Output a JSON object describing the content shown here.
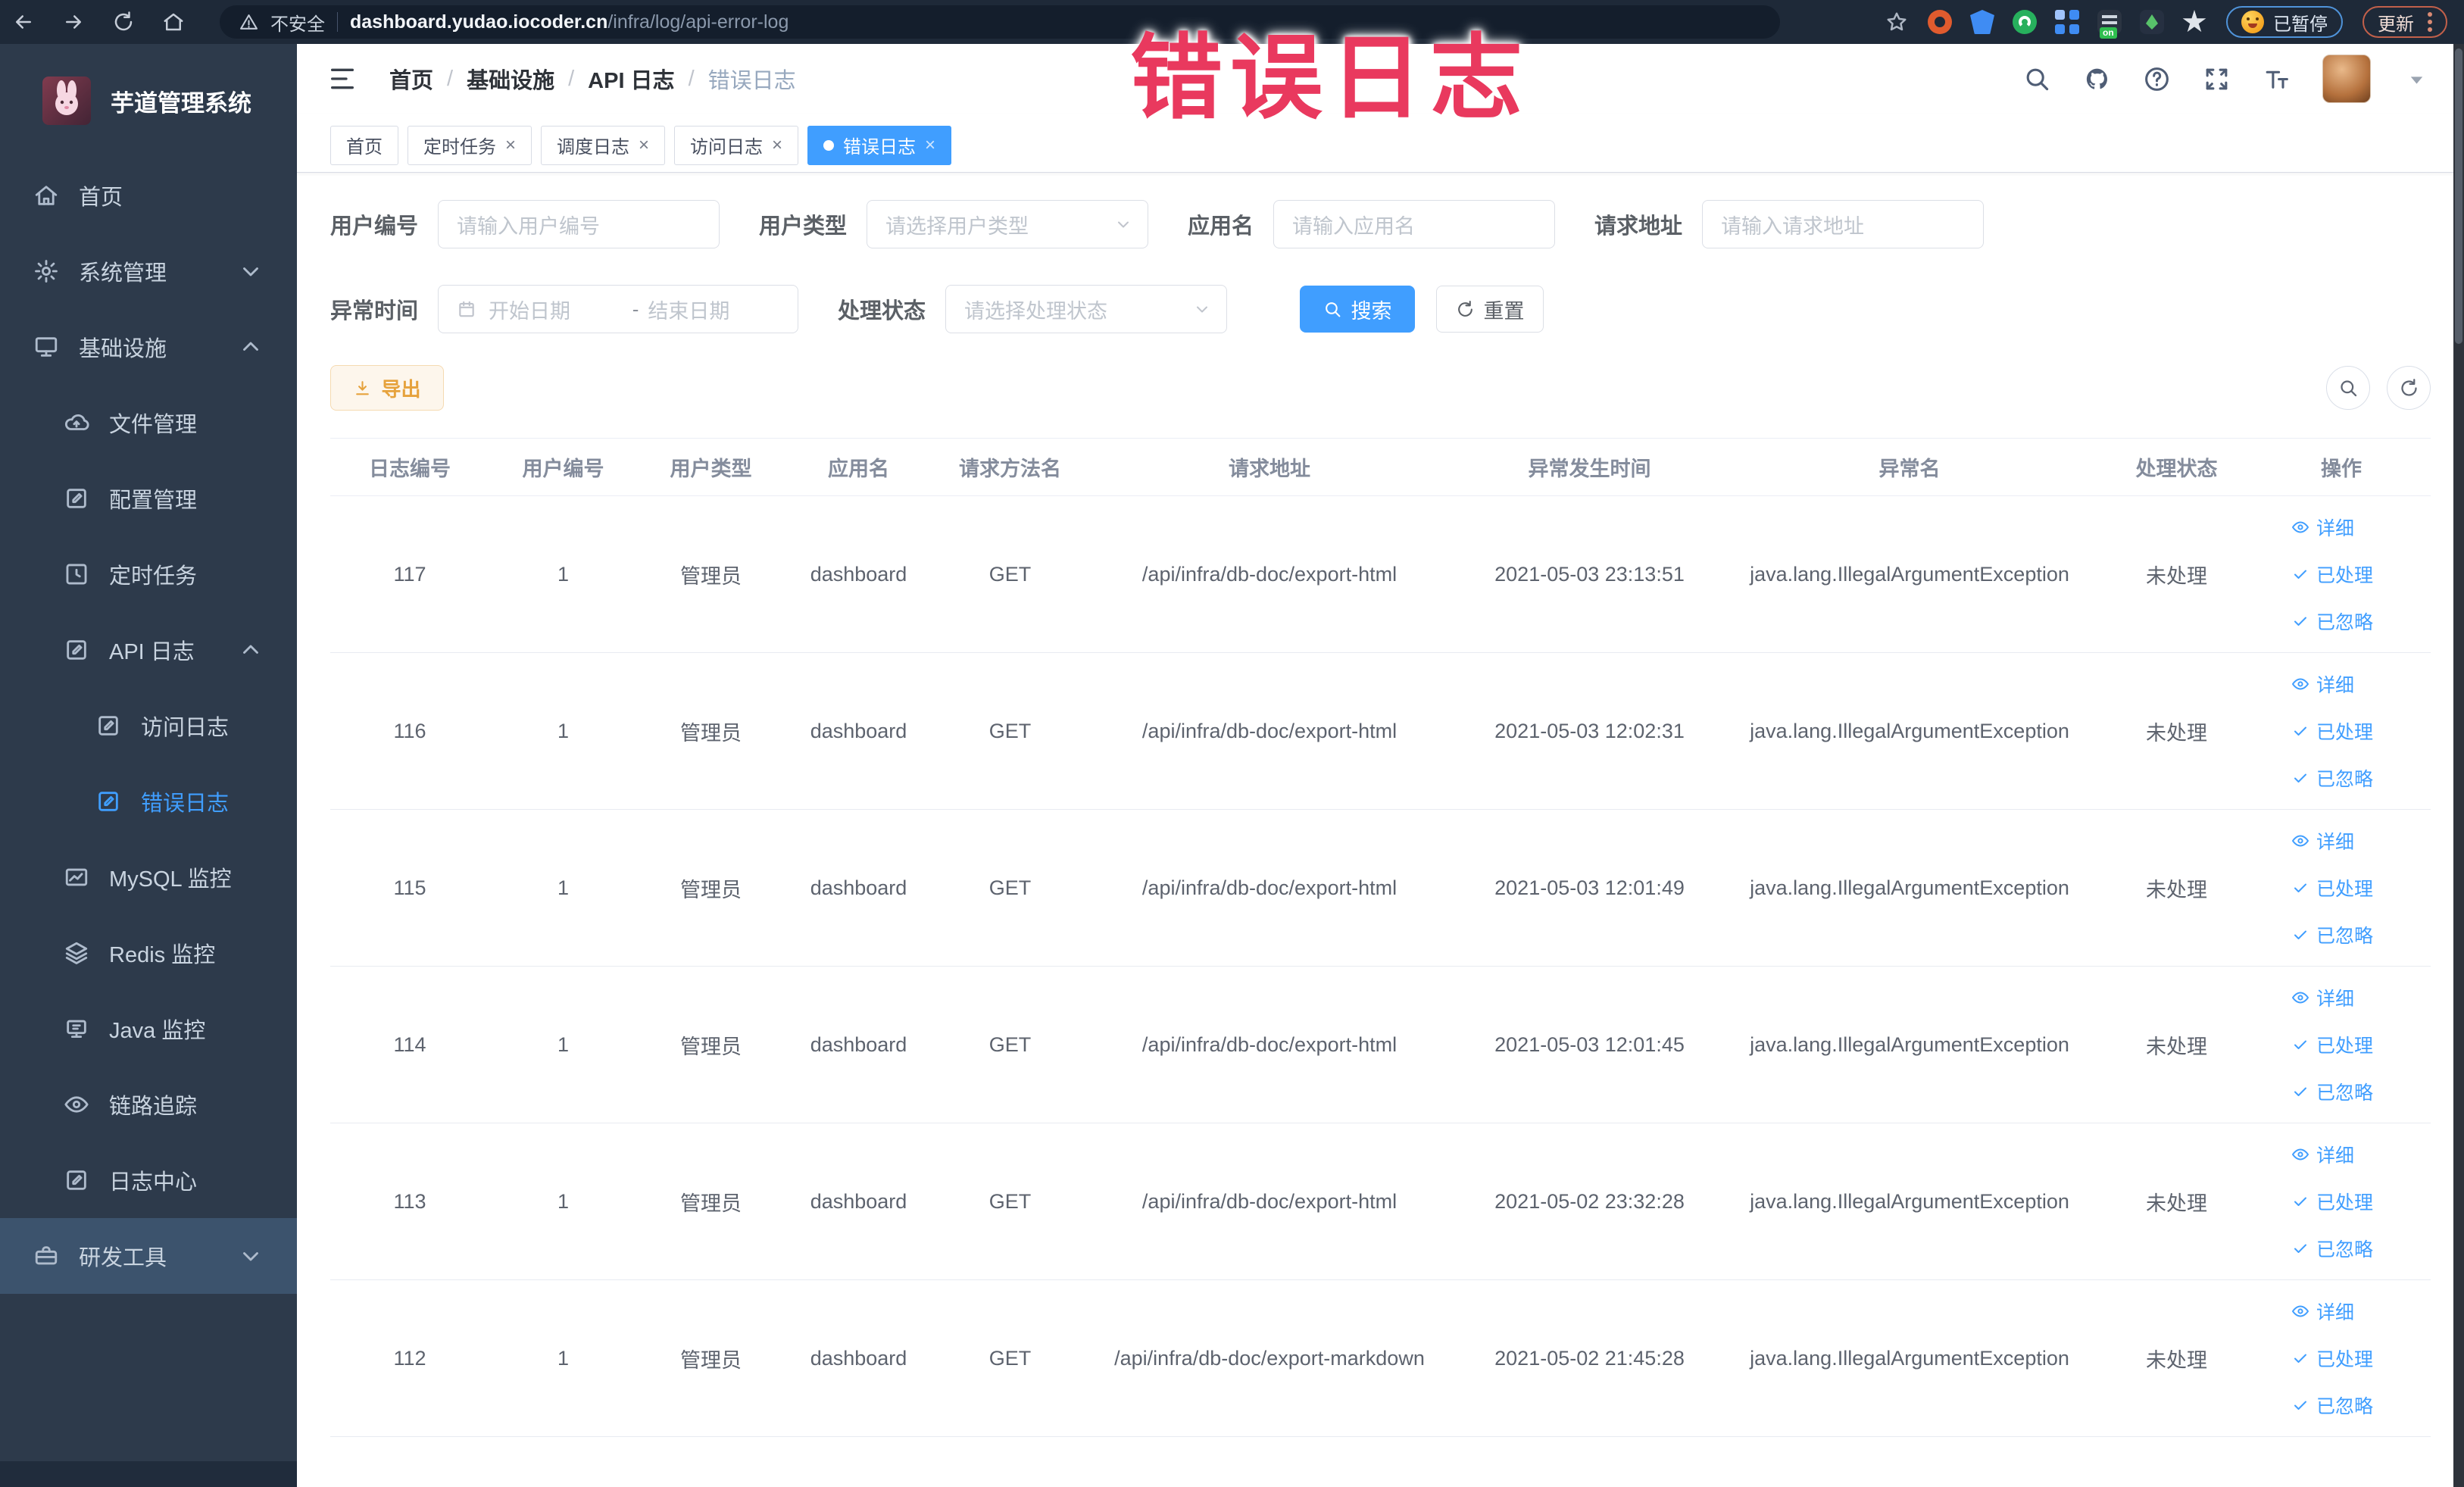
{
  "colors": {
    "accent": "#409eff",
    "warning": "#e6a23c",
    "overlay_red": "#e9395e",
    "sidebar_bg": "#2d3a4b"
  },
  "overlay": {
    "text": "错误日志"
  },
  "browser": {
    "security_label": "不安全",
    "url_domain": "dashboard.yudao.iocoder.cn",
    "url_path": "/infra/log/api-error-log",
    "paused_label": "已暂停",
    "update_label": "更新",
    "extensions": [
      {
        "name": "adblock-extension-icon",
        "style": "donut",
        "color": "#e05b2e"
      },
      {
        "name": "shield-extension-icon",
        "style": "shield",
        "color": "#3f8cf3"
      },
      {
        "name": "green-check-extension-icon",
        "style": "circle",
        "color": "#27b05d"
      },
      {
        "name": "grid-extension-icon",
        "style": "grid",
        "color": "#3f8cf3"
      },
      {
        "name": "switch-extension-icon",
        "style": "dark",
        "color": "#2b3442",
        "badge": "on"
      },
      {
        "name": "sprout-extension-icon",
        "style": "sprout",
        "color": "#263041"
      },
      {
        "name": "pin-extension-icon",
        "style": "puzzle",
        "color": "#dfe4ea"
      }
    ]
  },
  "sidebar": {
    "title": "芋道管理系统",
    "items": [
      {
        "key": "home",
        "label": "首页",
        "icon": "home",
        "level": 1
      },
      {
        "key": "system",
        "label": "系统管理",
        "icon": "gear",
        "level": 1,
        "chevron": "down"
      },
      {
        "key": "infra",
        "label": "基础设施",
        "icon": "monitor",
        "level": 1,
        "chevron": "up"
      },
      {
        "key": "file",
        "label": "文件管理",
        "icon": "cloud",
        "level": 2
      },
      {
        "key": "config",
        "label": "配置管理",
        "icon": "edit",
        "level": 2
      },
      {
        "key": "job",
        "label": "定时任务",
        "icon": "clock",
        "level": 2
      },
      {
        "key": "api-log",
        "label": "API 日志",
        "icon": "edit",
        "level": 2,
        "chevron": "up"
      },
      {
        "key": "access-log",
        "label": "访问日志",
        "icon": "edit",
        "level": 3
      },
      {
        "key": "error-log",
        "label": "错误日志",
        "icon": "edit",
        "level": 3,
        "active": true
      },
      {
        "key": "mysql",
        "label": "MySQL 监控",
        "icon": "chart",
        "level": 2
      },
      {
        "key": "redis",
        "label": "Redis 监控",
        "icon": "layers",
        "level": 2
      },
      {
        "key": "java",
        "label": "Java 监控",
        "icon": "java",
        "level": 2
      },
      {
        "key": "trace",
        "label": "链路追踪",
        "icon": "eye",
        "level": 2
      },
      {
        "key": "log-center",
        "label": "日志中心",
        "icon": "edit",
        "level": 2
      },
      {
        "key": "dev-tools",
        "label": "研发工具",
        "icon": "briefcase",
        "level": 1,
        "chevron": "down",
        "tone": "light"
      }
    ]
  },
  "header": {
    "breadcrumb": [
      "首页",
      "基础设施",
      "API 日志",
      "错误日志"
    ]
  },
  "tabs": [
    {
      "label": "首页",
      "active": false,
      "closable": false
    },
    {
      "label": "定时任务",
      "active": false,
      "closable": true
    },
    {
      "label": "调度日志",
      "active": false,
      "closable": true
    },
    {
      "label": "访问日志",
      "active": false,
      "closable": true
    },
    {
      "label": "错误日志",
      "active": true,
      "closable": true
    }
  ],
  "filters": {
    "row1": [
      {
        "key": "user-id",
        "label": "用户编号",
        "type": "input",
        "placeholder": "请输入用户编号"
      },
      {
        "key": "user-type",
        "label": "用户类型",
        "type": "select",
        "placeholder": "请选择用户类型"
      },
      {
        "key": "app-name",
        "label": "应用名",
        "type": "input",
        "placeholder": "请输入应用名"
      },
      {
        "key": "req-url",
        "label": "请求地址",
        "type": "input",
        "placeholder": "请输入请求地址"
      }
    ],
    "time": {
      "label": "异常时间",
      "start_placeholder": "开始日期",
      "separator": "-",
      "end_placeholder": "结束日期"
    },
    "status": {
      "label": "处理状态",
      "placeholder": "请选择处理状态"
    },
    "search_label": "搜索",
    "reset_label": "重置"
  },
  "toolbar": {
    "export_label": "导出"
  },
  "table": {
    "headers": [
      "日志编号",
      "用户编号",
      "用户类型",
      "应用名",
      "请求方法名",
      "请求地址",
      "异常发生时间",
      "异常名",
      "处理状态",
      "操作"
    ],
    "actions": [
      "详细",
      "已处理",
      "已忽略"
    ],
    "rows": [
      {
        "id": "117",
        "user_id": "1",
        "user_type": "管理员",
        "app": "dashboard",
        "method": "GET",
        "url": "/api/infra/db-doc/export-html",
        "time": "2021-05-03 23:13:51",
        "exception": "java.lang.IllegalArgumentException",
        "status": "未处理"
      },
      {
        "id": "116",
        "user_id": "1",
        "user_type": "管理员",
        "app": "dashboard",
        "method": "GET",
        "url": "/api/infra/db-doc/export-html",
        "time": "2021-05-03 12:02:31",
        "exception": "java.lang.IllegalArgumentException",
        "status": "未处理"
      },
      {
        "id": "115",
        "user_id": "1",
        "user_type": "管理员",
        "app": "dashboard",
        "method": "GET",
        "url": "/api/infra/db-doc/export-html",
        "time": "2021-05-03 12:01:49",
        "exception": "java.lang.IllegalArgumentException",
        "status": "未处理"
      },
      {
        "id": "114",
        "user_id": "1",
        "user_type": "管理员",
        "app": "dashboard",
        "method": "GET",
        "url": "/api/infra/db-doc/export-html",
        "time": "2021-05-03 12:01:45",
        "exception": "java.lang.IllegalArgumentException",
        "status": "未处理"
      },
      {
        "id": "113",
        "user_id": "1",
        "user_type": "管理员",
        "app": "dashboard",
        "method": "GET",
        "url": "/api/infra/db-doc/export-html",
        "time": "2021-05-02 23:32:28",
        "exception": "java.lang.IllegalArgumentException",
        "status": "未处理"
      },
      {
        "id": "112",
        "user_id": "1",
        "user_type": "管理员",
        "app": "dashboard",
        "method": "GET",
        "url": "/api/infra/db-doc/export-markdown",
        "time": "2021-05-02 21:45:28",
        "exception": "java.lang.IllegalArgumentException",
        "status": "未处理"
      }
    ]
  }
}
